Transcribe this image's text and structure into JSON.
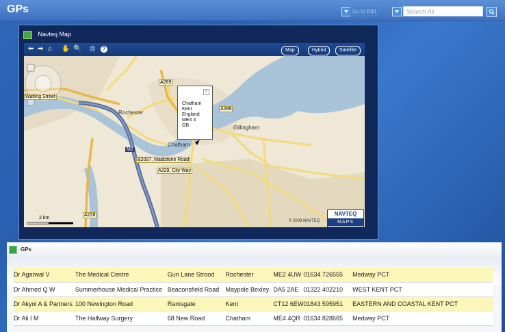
{
  "app": {
    "title": "GPs",
    "goto_edit": "Go to Edit",
    "search_placeholder": "Search All"
  },
  "map_panel": {
    "title": "Navteq Map",
    "modes": [
      "Map",
      "Hybrid",
      "Satellite"
    ],
    "labels": {
      "watling": "Watling Street",
      "rochester": "Rochester",
      "chatham": "Chatham",
      "gillingham": "Gillingham",
      "a289_a": "A289",
      "a289_b": "A289",
      "m2": "M2",
      "b2097": "B2097, Maidstone Road",
      "a229": "A229, City Way",
      "a228": "A228",
      "scale": "2 km",
      "copyright": "© 2009 NAVTEQ",
      "logo_top": "NAVTEQ",
      "logo_bottom": "MAPS"
    },
    "popup": [
      "Chatham",
      "Kent",
      "England",
      "ME4 4",
      "GB"
    ]
  },
  "gp_panel": {
    "title": "GPs",
    "rows": [
      {
        "name": "Dr Agarwal V",
        "practice": "The Medical Centre",
        "street": "Gun Lane Strood",
        "town": "Rochester",
        "postcode": "ME2 4UW",
        "phone": "01634 726555",
        "pct": "Medway PCT",
        "highlight": true
      },
      {
        "name": "Dr Ahmed Q W",
        "practice": "Summerhouse Medical Practice",
        "street": "Beaconsfield Road",
        "town": "Maypole Bexley",
        "postcode": "DA5 2AE",
        "phone": "01322 402210",
        "pct": "WEST KENT PCT",
        "highlight": false
      },
      {
        "name": "Dr Akyol A & Partners",
        "practice": "100 Newington Road",
        "street": "Ramsgate",
        "town": "Kent",
        "postcode": "CT12 6EW",
        "phone": "01843 595951",
        "pct": "EASTERN AND COASTAL KENT PCT",
        "highlight": true
      },
      {
        "name": "Dr Ali I M",
        "practice": "The Halfway Surgery",
        "street": "68 New Road",
        "town": "Chatham",
        "postcode": "ME4 4QR",
        "phone": "01634 828665",
        "pct": "Medway PCT",
        "highlight": false
      }
    ]
  },
  "colors": {
    "row_highlight": "#fcf6b8",
    "map_water": "#a9c3d9",
    "motorway": "#5a6f9c"
  }
}
